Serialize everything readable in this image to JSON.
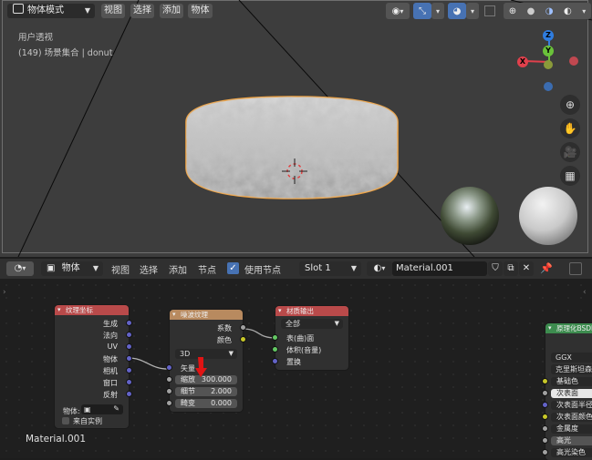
{
  "viewport": {
    "mode_label": "物体模式",
    "menu": [
      "视图",
      "选择",
      "添加",
      "物体"
    ],
    "overlay_line1": "用户透视",
    "overlay_line2": "(149) 场景集合 | donut",
    "gizmo": {
      "x": "X",
      "y": "Y",
      "z": "Z"
    }
  },
  "node_editor": {
    "header": {
      "type_label": "物体",
      "menu": [
        "视图",
        "选择",
        "添加",
        "节点"
      ],
      "use_nodes_label": "使用节点",
      "use_nodes_checked": true,
      "slot_label": "Slot 1",
      "material_name": "Material.001"
    },
    "area_label": "Material.001",
    "nodes": {
      "texcoord": {
        "title": "纹理坐标",
        "outputs": [
          "生成",
          "法向",
          "UV",
          "物体",
          "相机",
          "窗口",
          "反射"
        ],
        "object_label": "物体:",
        "from_instancer": "来自实例"
      },
      "noise": {
        "title": "噪波纹理",
        "outputs": [
          "系数",
          "颜色"
        ],
        "dimension": "3D",
        "vector_label": "矢量",
        "fields": [
          {
            "label": "缩放",
            "value": "300.000"
          },
          {
            "label": "细节",
            "value": "2.000"
          },
          {
            "label": "畸变",
            "value": "0.000"
          }
        ]
      },
      "output": {
        "title": "材质输出",
        "target": "全部",
        "inputs": [
          "表(曲)面",
          "体积(音量)",
          "置换"
        ]
      },
      "bsdf": {
        "title": "原理化BSDF",
        "distribution": "GGX",
        "subsurface_method": "克里斯坦森-",
        "rows": [
          "基础色",
          "次表面",
          "次表面半径",
          "次表面颜色",
          "金属度",
          "高光",
          "高光染色"
        ]
      }
    }
  }
}
